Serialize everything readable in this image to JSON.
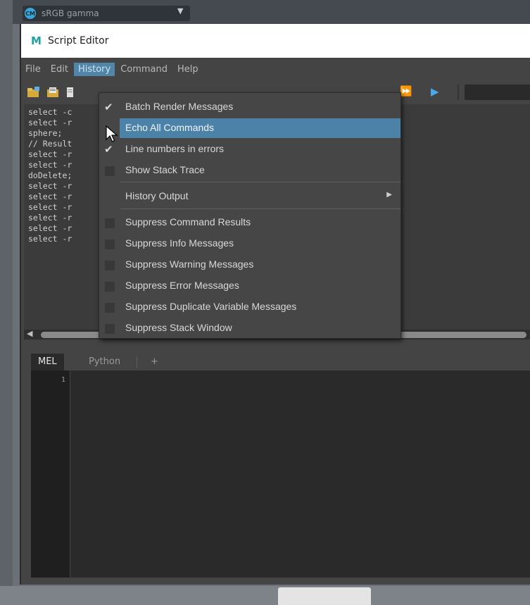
{
  "colorspace": {
    "label": "sRGB gamma",
    "icon": "color-management-icon"
  },
  "window": {
    "title": "Script Editor",
    "icon": "maya-logo-icon"
  },
  "menubar": [
    "File",
    "Edit",
    "History",
    "Command",
    "Help"
  ],
  "active_menu": "History",
  "history_lines": [
    "select -c",
    "select -r",
    "sphere;",
    "// Result",
    "select -r",
    "select -r",
    "doDelete;",
    "select -r",
    "select -r",
    "select -r",
    "select -r",
    "select -r",
    "select -r"
  ],
  "history_menu": {
    "items": [
      {
        "label": "Batch Render Messages",
        "checked": true
      },
      {
        "label": "Echo All Commands",
        "checked": false,
        "highlighted": true
      },
      {
        "label": "Line numbers in errors",
        "checked": true
      },
      {
        "label": "Show Stack Trace",
        "checked": false
      },
      {
        "label": "History Output",
        "submenu": true
      },
      {
        "label": "Suppress Command Results",
        "checked": false
      },
      {
        "label": "Suppress Info Messages",
        "checked": false
      },
      {
        "label": "Suppress Warning Messages",
        "checked": false
      },
      {
        "label": "Suppress Error Messages",
        "checked": false
      },
      {
        "label": "Suppress Duplicate Variable Messages",
        "checked": false
      },
      {
        "label": "Suppress Stack Window",
        "checked": false
      }
    ]
  },
  "tabs": {
    "mel": "MEL",
    "python": "Python",
    "add": "+"
  },
  "editor": {
    "line_number": "1"
  },
  "colors": {
    "accent": "#4d82a8",
    "panel": "#444444",
    "editor": "#2a2a2a"
  }
}
